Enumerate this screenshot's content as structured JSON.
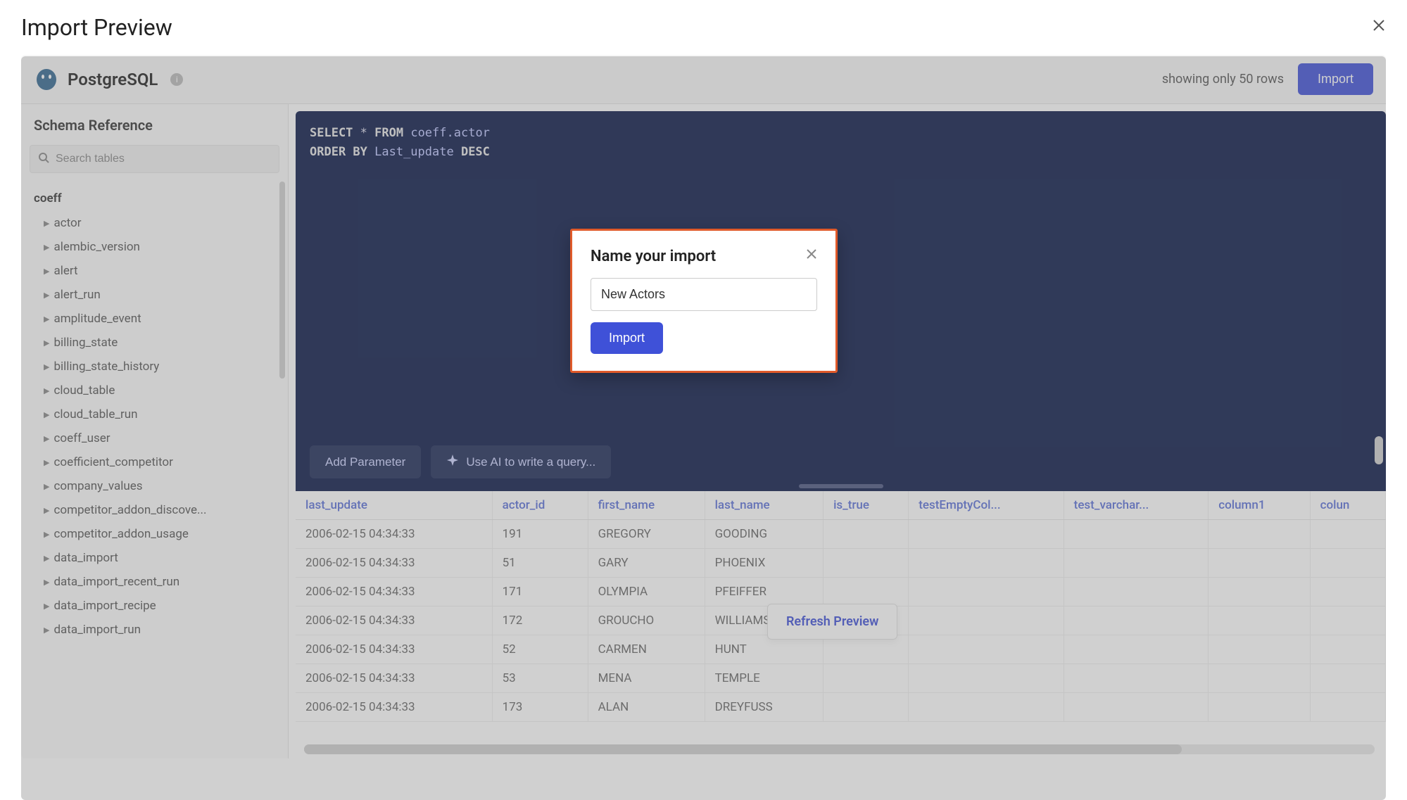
{
  "outer": {
    "title": "Import Preview"
  },
  "header": {
    "db_name": "PostgreSQL",
    "row_count_text": "showing only 50 rows",
    "import_label": "Import"
  },
  "sidebar": {
    "title": "Schema Reference",
    "search_placeholder": "Search tables",
    "schema": "coeff",
    "tables": [
      "actor",
      "alembic_version",
      "alert",
      "alert_run",
      "amplitude_event",
      "billing_state",
      "billing_state_history",
      "cloud_table",
      "cloud_table_run",
      "coeff_user",
      "coefficient_competitor",
      "company_values",
      "competitor_addon_discove...",
      "competitor_addon_usage",
      "data_import",
      "data_import_recent_run",
      "data_import_recipe",
      "data_import_run"
    ]
  },
  "editor": {
    "line1_kw1": "SELECT",
    "line1_star": " * ",
    "line1_kw2": "FROM",
    "line1_ident": " coeff.actor",
    "line2_kw1": "ORDER BY",
    "line2_ident": " Last_update ",
    "line2_kw2": "DESC",
    "add_param_label": "Add Parameter",
    "ai_query_label": "Use AI to write a query..."
  },
  "table": {
    "columns": [
      "last_update",
      "actor_id",
      "first_name",
      "last_name",
      "is_true",
      "testEmptyCol...",
      "test_varchar...",
      "column1",
      "colun"
    ],
    "rows": [
      {
        "last_update": "2006-02-15 04:34:33",
        "actor_id": "191",
        "first_name": "GREGORY",
        "last_name": "GOODING"
      },
      {
        "last_update": "2006-02-15 04:34:33",
        "actor_id": "51",
        "first_name": "GARY",
        "last_name": "PHOENIX"
      },
      {
        "last_update": "2006-02-15 04:34:33",
        "actor_id": "171",
        "first_name": "OLYMPIA",
        "last_name": "PFEIFFER"
      },
      {
        "last_update": "2006-02-15 04:34:33",
        "actor_id": "172",
        "first_name": "GROUCHO",
        "last_name": "WILLIAMS"
      },
      {
        "last_update": "2006-02-15 04:34:33",
        "actor_id": "52",
        "first_name": "CARMEN",
        "last_name": "HUNT"
      },
      {
        "last_update": "2006-02-15 04:34:33",
        "actor_id": "53",
        "first_name": "MENA",
        "last_name": "TEMPLE"
      },
      {
        "last_update": "2006-02-15 04:34:33",
        "actor_id": "173",
        "first_name": "ALAN",
        "last_name": "DREYFUSS"
      }
    ],
    "refresh_label": "Refresh Preview"
  },
  "modal": {
    "title": "Name your import",
    "input_value": "New Actors",
    "import_label": "Import"
  }
}
